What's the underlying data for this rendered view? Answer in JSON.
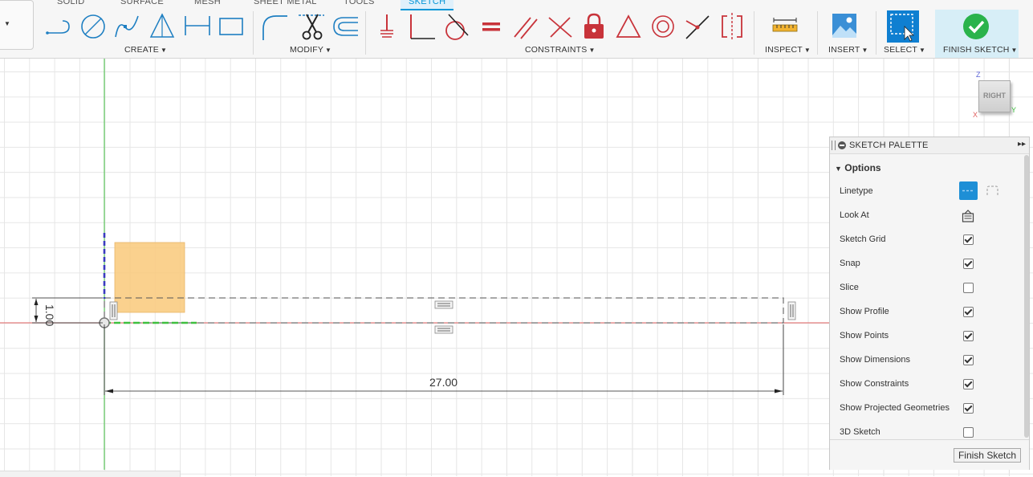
{
  "tabs": [
    {
      "label": "SOLID"
    },
    {
      "label": "SURFACE"
    },
    {
      "label": "MESH"
    },
    {
      "label": "SHEET METAL"
    },
    {
      "label": "TOOLS"
    },
    {
      "label": "SKETCH",
      "active": true
    }
  ],
  "groups": {
    "create": "CREATE",
    "modify": "MODIFY",
    "constraints": "CONSTRAINTS",
    "inspect": "INSPECT",
    "insert": "INSERT",
    "select": "SELECT",
    "finish": "FINISH SKETCH"
  },
  "icons": {
    "create": [
      "line-icon",
      "circle-icon",
      "spline-icon",
      "triangle-icon",
      "dimension-icon",
      "rectangle-icon"
    ],
    "modify": [
      "fillet-icon",
      "trim-icon",
      "offset-icon"
    ],
    "constraints": [
      "fix-icon",
      "perpendicular-icon",
      "tangent-icon",
      "equal-icon",
      "parallel-icon",
      "perpendicular-lines-icon",
      "lock-icon",
      "triangle-constraint-icon",
      "concentric-icon",
      "midpoint-icon",
      "symmetry-icon"
    ],
    "inspect": "measure-icon",
    "insert": "image-icon",
    "select": "select-icon",
    "finish": "checkmark-icon"
  },
  "canvas": {
    "dim_horizontal": "27.00",
    "dim_vertical": "1.00"
  },
  "viewcube": {
    "face": "RIGHT",
    "z": "Z",
    "y": "Y",
    "x": "X"
  },
  "palette": {
    "title": "SKETCH PALETTE",
    "section": "Options",
    "rows": [
      {
        "label": "Linetype",
        "type": "linetype"
      },
      {
        "label": "Look At",
        "type": "lookat"
      },
      {
        "label": "Sketch Grid",
        "checked": true
      },
      {
        "label": "Snap",
        "checked": true
      },
      {
        "label": "Slice",
        "checked": false
      },
      {
        "label": "Show Profile",
        "checked": true
      },
      {
        "label": "Show Points",
        "checked": true
      },
      {
        "label": "Show Dimensions",
        "checked": true
      },
      {
        "label": "Show Constraints",
        "checked": true
      },
      {
        "label": "Show Projected Geometries",
        "checked": true
      },
      {
        "label": "3D Sketch",
        "checked": false
      }
    ],
    "finish_button": "Finish Sketch"
  },
  "colors": {
    "accent": "#0696d7",
    "finish_green": "#2ab34b",
    "constraint_red": "#c8333a",
    "profile_fill": "#f9c97a",
    "axis_green": "#3fbf3f",
    "axis_red": "#e06060"
  }
}
